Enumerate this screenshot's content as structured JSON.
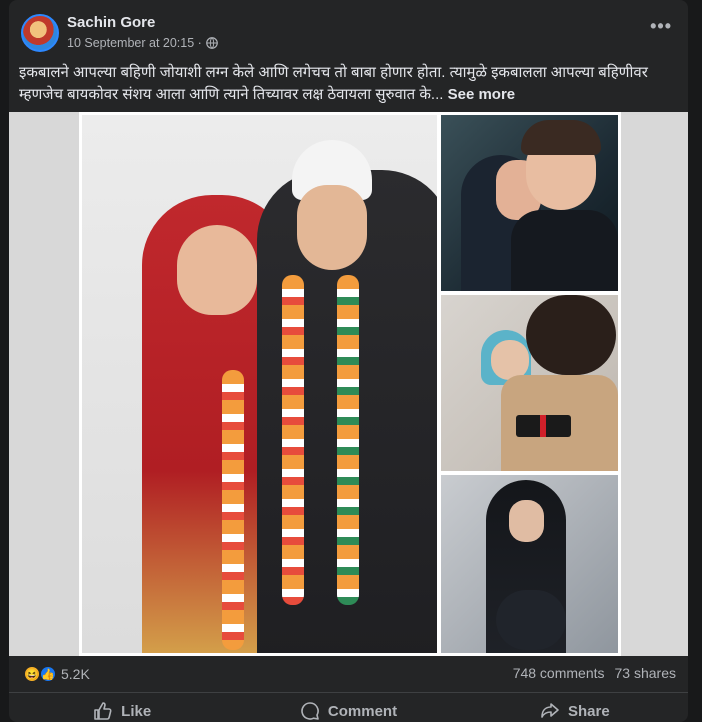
{
  "post": {
    "author": "Sachin Gore",
    "timestamp": "10 September at 20:15 ·",
    "text": "इकबालने आपल्या बहिणी जोयाशी लग्न केले आणि लगेचच तो बाबा होणार होता. त्यामुळे इकबालला आपल्या बहिणीवर म्हणजेच बायकोवर संशय आला आणि त्याने तिच्यावर लक्ष ठेवायला सुरुवात के...",
    "see_more": "See more"
  },
  "icons": {
    "more": "more-options-icon",
    "audience": "globe-icon",
    "reactions": [
      "haha-reaction-icon",
      "like-reaction-icon"
    ]
  },
  "stats": {
    "reactions": "5.2K",
    "comments": "748 comments",
    "shares": "73 shares"
  },
  "actions": {
    "like": "Like",
    "comment": "Comment",
    "share": "Share"
  },
  "colors": {
    "card": "#242526",
    "background": "#18191a",
    "like_blue": "#1877f2",
    "haha_yellow": "#f7b125"
  }
}
